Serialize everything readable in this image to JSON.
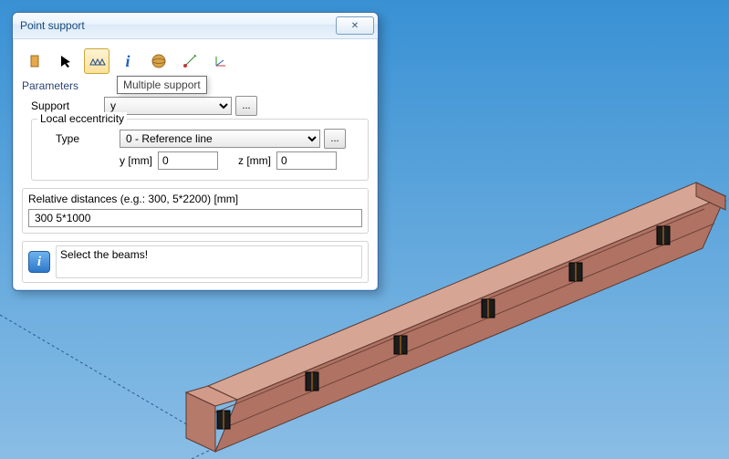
{
  "dialog": {
    "title": "Point support",
    "close_label": "✕",
    "tooltip": "Multiple support",
    "parameters_label": "Parameters",
    "support_label": "Support",
    "support_value": "y",
    "eccentricity": {
      "legend": "Local eccentricity",
      "type_label": "Type",
      "type_value": "0 - Reference line",
      "y_label": "y [mm]",
      "y_value": "0",
      "z_label": "z [mm]",
      "z_value": "0"
    },
    "distances": {
      "legend": "Relative distances (e.g.: 300, 5*2200) [mm]",
      "value": "300 5*1000"
    },
    "hint": "Select the beams!",
    "ellipsis": "..."
  }
}
